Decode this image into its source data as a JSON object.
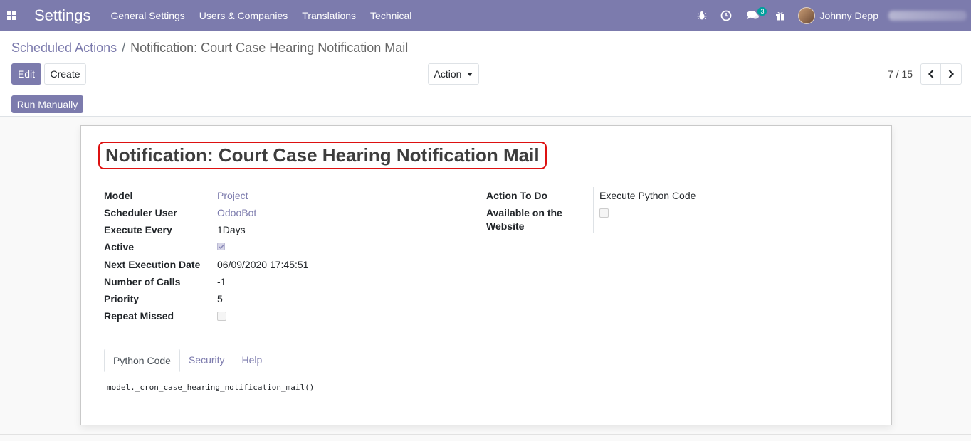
{
  "navbar": {
    "app_title": "Settings",
    "menu": [
      "General Settings",
      "Users & Companies",
      "Translations",
      "Technical"
    ],
    "messages_badge": "3",
    "user_name": "Johnny Depp",
    "color": "#7c7bad"
  },
  "breadcrumb": {
    "parent": "Scheduled Actions",
    "separator": "/",
    "current": "Notification: Court Case Hearing Notification Mail"
  },
  "toolbar": {
    "edit_label": "Edit",
    "create_label": "Create",
    "action_label": "Action"
  },
  "pager": {
    "value": "7 / 15"
  },
  "statusbar": {
    "run_manually_label": "Run Manually"
  },
  "form": {
    "title": "Notification: Court Case Hearing Notification Mail",
    "left_fields": {
      "model": {
        "label": "Model",
        "value": "Project"
      },
      "scheduler_user": {
        "label": "Scheduler User",
        "value": "OdooBot"
      },
      "execute_every": {
        "label": "Execute Every",
        "value": "1Days"
      },
      "active": {
        "label": "Active",
        "checked": true
      },
      "next_execution_date": {
        "label": "Next Execution Date",
        "value": "06/09/2020 17:45:51"
      },
      "number_of_calls": {
        "label": "Number of Calls",
        "value": "-1"
      },
      "priority": {
        "label": "Priority",
        "value": "5"
      },
      "repeat_missed": {
        "label": "Repeat Missed",
        "checked": false
      }
    },
    "right_fields": {
      "action_to_do": {
        "label": "Action To Do",
        "value": "Execute Python Code"
      },
      "available_on_website": {
        "label_line1": "Available on the",
        "label_line2": "Website",
        "checked": false
      }
    },
    "tabs": [
      "Python Code",
      "Security",
      "Help"
    ],
    "active_tab": "Python Code",
    "code": "model._cron_case_hearing_notification_mail()"
  }
}
